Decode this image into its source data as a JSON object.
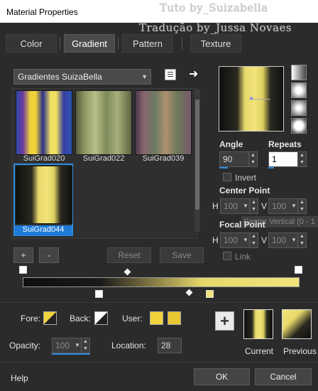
{
  "window": {
    "title": "Material Properties"
  },
  "watermark": {
    "line1": "Tuto by_Suizabella",
    "line2": "Tradução by_Jussa Novaes"
  },
  "tabs": [
    {
      "label": "Color",
      "active": false
    },
    {
      "label": "Gradient",
      "active": true
    },
    {
      "label": "Pattern",
      "active": false
    },
    {
      "label": "Texture",
      "active": false
    }
  ],
  "library": {
    "selected": "Gradientes SuizaBella",
    "icons": [
      "gradient-list-icon",
      "arrow-right-icon"
    ]
  },
  "swatches": [
    {
      "label": "SuiGrad020",
      "selected": false
    },
    {
      "label": "SuiGrad022",
      "selected": false
    },
    {
      "label": "SuiGrad039",
      "selected": false
    },
    {
      "label": "SuiGrad044",
      "selected": true
    }
  ],
  "preview": {
    "center_marker": "crosshair-icon"
  },
  "style_buttons": [
    "linear-icon",
    "rectangular-icon",
    "sunburst-icon",
    "radial-icon"
  ],
  "angle": {
    "label": "Angle",
    "value": "90"
  },
  "repeats": {
    "label": "Repeats",
    "value": "1"
  },
  "invert": {
    "label": "Invert",
    "checked": false
  },
  "center_point": {
    "label": "Center Point",
    "h_label": "H",
    "h": "100",
    "v_label": "V",
    "v": "100"
  },
  "tooltip": "Center Vertical (0 - 1",
  "focal_point": {
    "label": "Focal Point",
    "h_label": "H",
    "h": "100",
    "v_label": "V",
    "v": "100"
  },
  "link": {
    "label": "Link",
    "checked": false
  },
  "edit_buttons": {
    "add": "+",
    "remove": "-",
    "reset": "Reset",
    "save": "Save"
  },
  "colors": {
    "fore_label": "Fore:",
    "back_label": "Back:",
    "user_label": "User:",
    "user_color": "#f0d23a",
    "user_color2": "#e8c830"
  },
  "opacity": {
    "label": "Opacity:",
    "value": "100"
  },
  "location": {
    "label": "Location:",
    "value": "28"
  },
  "current_label": "Current",
  "previous_label": "Previous",
  "footer": {
    "help": "Help",
    "ok": "OK",
    "cancel": "Cancel"
  }
}
